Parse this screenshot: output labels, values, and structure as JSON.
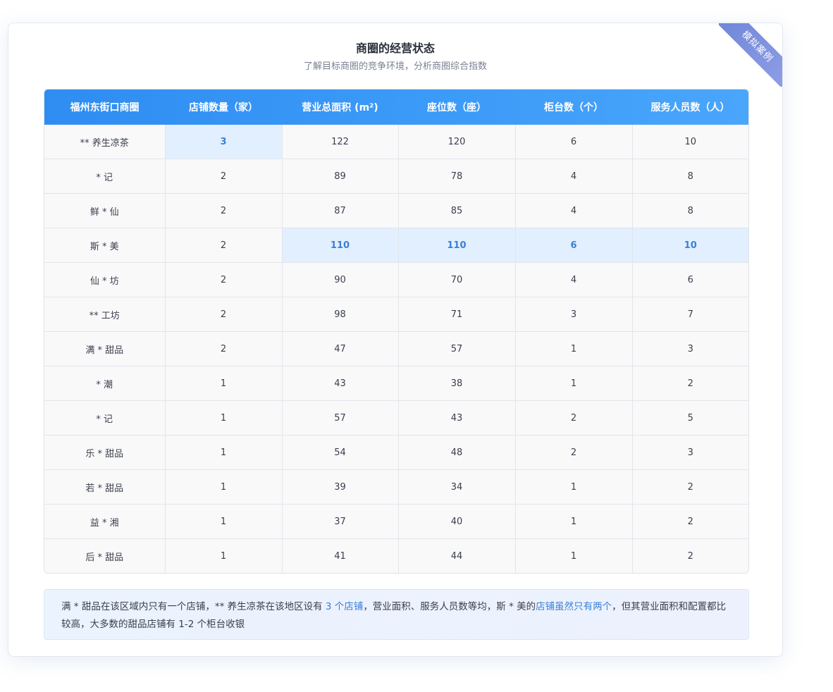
{
  "ribbon": "模拟案例",
  "title": "商圈的经营状态",
  "subtitle": "了解目标商圈的竞争环境，分析商圈综合指数",
  "table": {
    "headers": [
      "福州东街口商圈",
      "店铺数量（家）",
      "营业总面积 (m²)",
      "座位数（座）",
      "柜台数（个）",
      "服务人员数（人）"
    ],
    "rows": [
      [
        "** 养生凉茶",
        "3",
        "122",
        "120",
        "6",
        "10"
      ],
      [
        "* 记",
        "2",
        "89",
        "78",
        "4",
        "8"
      ],
      [
        "鲜 * 仙",
        "2",
        "87",
        "85",
        "4",
        "8"
      ],
      [
        "斯 * 美",
        "2",
        "110",
        "110",
        "6",
        "10"
      ],
      [
        "仙 * 坊",
        "2",
        "90",
        "70",
        "4",
        "6"
      ],
      [
        "** 工坊",
        "2",
        "98",
        "71",
        "3",
        "7"
      ],
      [
        "满 * 甜品",
        "2",
        "47",
        "57",
        "1",
        "3"
      ],
      [
        "* 潮",
        "1",
        "43",
        "38",
        "1",
        "2"
      ],
      [
        "* 记",
        "1",
        "57",
        "43",
        "2",
        "5"
      ],
      [
        "乐 * 甜品",
        "1",
        "54",
        "48",
        "2",
        "3"
      ],
      [
        "若 * 甜品",
        "1",
        "39",
        "34",
        "1",
        "2"
      ],
      [
        "益 * 湘",
        "1",
        "37",
        "40",
        "1",
        "2"
      ],
      [
        "后 * 甜品",
        "1",
        "41",
        "44",
        "1",
        "2"
      ]
    ]
  },
  "note": {
    "part1": "满 * 甜品在该区域内只有一个店铺，** 养生凉茶在该地区设有 ",
    "link1": "3 个店铺",
    "part2": "，营业面积、服务人员数等均，斯 * 美的",
    "link2": "店铺虽然只有两个",
    "part3": "，但其营业面积和配置都比较高，大多数的甜品店铺有 1-2 个柜台收银"
  }
}
